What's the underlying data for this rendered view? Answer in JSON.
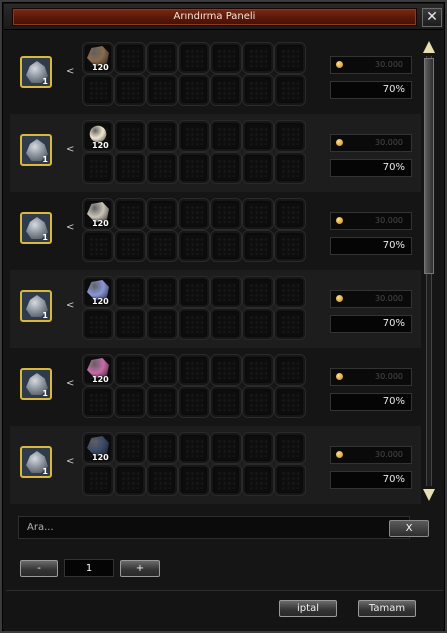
{
  "window": {
    "title": "Arındırma Paneli",
    "close_label": "✕"
  },
  "colors": {
    "title_plate": "#5a1808",
    "slot_border": "#d9b83a",
    "panel_bg": "#151515"
  },
  "rows": [
    {
      "source_count": "1",
      "arrow": "<",
      "item_count": "120",
      "item_icon": "ore-brown-icon",
      "ore_color": "#8a6a4a",
      "cost": "30.000",
      "success_rate": "70%"
    },
    {
      "source_count": "1",
      "arrow": "<",
      "item_count": "120",
      "item_icon": "pearl-icon",
      "ore_color": "#efe6cf",
      "cost": "30.000",
      "success_rate": "70%"
    },
    {
      "source_count": "1",
      "arrow": "<",
      "item_count": "120",
      "item_icon": "ore-white-icon",
      "ore_color": "#c9c3b8",
      "cost": "30.000",
      "success_rate": "70%"
    },
    {
      "source_count": "1",
      "arrow": "<",
      "item_count": "120",
      "item_icon": "ore-blue-icon",
      "ore_color": "#8a96d8",
      "cost": "30.000",
      "success_rate": "70%"
    },
    {
      "source_count": "1",
      "arrow": "<",
      "item_count": "120",
      "item_icon": "ore-pink-icon",
      "ore_color": "#c86aa8",
      "cost": "30.000",
      "success_rate": "70%"
    },
    {
      "source_count": "1",
      "arrow": "<",
      "item_count": "120",
      "item_icon": "ore-dark-icon",
      "ore_color": "#3a4a6a",
      "cost": "30.000",
      "success_rate": "70%"
    }
  ],
  "search": {
    "placeholder": "Ara...",
    "clear_label": "X"
  },
  "quantity": {
    "minus_label": "-",
    "value": "1",
    "plus_label": "+"
  },
  "footer": {
    "cancel_label": "iptal",
    "ok_label": "Tamam"
  }
}
